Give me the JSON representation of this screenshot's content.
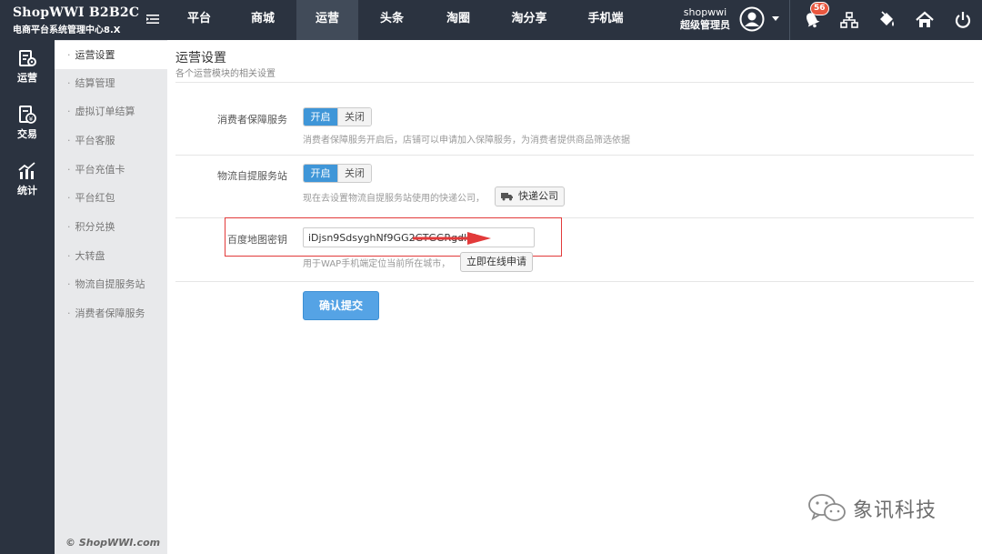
{
  "header": {
    "brand": "ShopWWI B2B2C",
    "subtitle": "电商平台系统管理中心8.X",
    "nav": [
      {
        "label": "平台",
        "active": false
      },
      {
        "label": "商城",
        "active": false
      },
      {
        "label": "运营",
        "active": true
      },
      {
        "label": "头条",
        "active": false
      },
      {
        "label": "淘圈",
        "active": false
      },
      {
        "label": "淘分享",
        "active": false
      },
      {
        "label": "手机端",
        "active": false
      }
    ],
    "user": {
      "name": "shopwwi",
      "role": "超级管理员"
    },
    "notification_count": "56",
    "icons": [
      "bell-icon",
      "sitemap-icon",
      "paint-bucket-icon",
      "home-icon",
      "power-icon"
    ]
  },
  "rail": [
    {
      "label": "运营",
      "icon": "operations-icon"
    },
    {
      "label": "交易",
      "icon": "trade-icon"
    },
    {
      "label": "统计",
      "icon": "stats-icon"
    }
  ],
  "submenu": [
    {
      "label": "运营设置",
      "active": true
    },
    {
      "label": "结算管理",
      "active": false
    },
    {
      "label": "虚拟订单结算",
      "active": false
    },
    {
      "label": "平台客服",
      "active": false
    },
    {
      "label": "平台充值卡",
      "active": false
    },
    {
      "label": "平台红包",
      "active": false
    },
    {
      "label": "积分兑换",
      "active": false
    },
    {
      "label": "大转盘",
      "active": false
    },
    {
      "label": "物流自提服务站",
      "active": false
    },
    {
      "label": "消费者保障服务",
      "active": false
    }
  ],
  "copyright": "© ShopWWI.com",
  "page": {
    "title": "运营设置",
    "subtitle": "各个运营模块的相关设置"
  },
  "form": {
    "guarantee": {
      "label": "消费者保障服务",
      "on": "开启",
      "off": "关闭",
      "selected": "开启",
      "hint": "消费者保障服务开启后，店铺可以申请加入保障服务，为消费者提供商品筛选依据"
    },
    "delivery": {
      "label": "物流自提服务站",
      "on": "开启",
      "off": "关闭",
      "selected": "开启",
      "hint": "现在去设置物流自提服务站使用的快递公司，",
      "button": "快递公司"
    },
    "baidu_key": {
      "label": "百度地图密钥",
      "value": "iDjsn9SdsyghNf9GG2GTGGRgdk7",
      "hint": "用于WAP手机端定位当前所在城市，",
      "button": "立即在线申请"
    },
    "submit": "确认提交"
  },
  "colors": {
    "header": "#2b3340",
    "accent": "#3f96d8",
    "highlight": "#e23a3a",
    "submit": "#55a3e5"
  },
  "watermark": "象讯科技"
}
